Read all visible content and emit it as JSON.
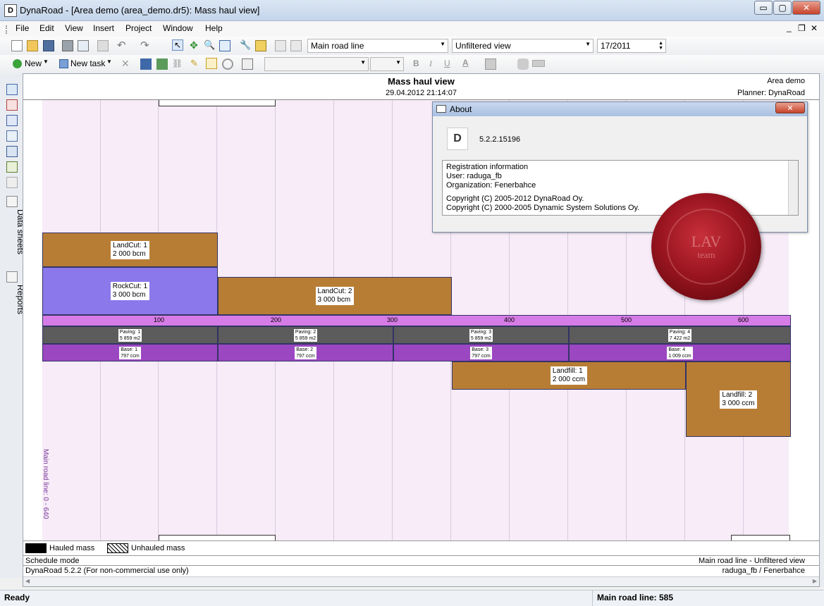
{
  "window": {
    "title": "DynaRoad - [Area demo (area_demo.dr5): Mass haul view]",
    "icon_letter": "D",
    "min": "▭",
    "max": "▢",
    "close": "✕"
  },
  "menu": [
    "File",
    "Edit",
    "View",
    "Insert",
    "Project",
    "Window",
    "Help"
  ],
  "mdi_controls": [
    "_",
    "❐",
    "✕"
  ],
  "toolbar1": {
    "road_line": "Main road line",
    "view": "Unfiltered view",
    "week": "17/2011"
  },
  "toolbar2": {
    "new_label": "New",
    "new_task_label": "New task",
    "bold": "B",
    "italic": "I",
    "underline": "U",
    "font_color": "A"
  },
  "sidebar": {
    "data_sheets": "Data sheets",
    "reports": "Reports"
  },
  "doc": {
    "title": "Mass haul view",
    "datetime": "29.04.2012 21:14:07",
    "project": "Area demo",
    "planner": "Planner: DynaRoad"
  },
  "chart_data": {
    "type": "mass-haul",
    "axis_label": "Main road line: 0 - 640",
    "station_ticks": [
      "100",
      "200",
      "300",
      "400",
      "500",
      "600"
    ],
    "cut_blocks": [
      {
        "label": "LandCut: 1",
        "value": "2 000 bcm",
        "start": 0,
        "end": 150
      },
      {
        "label": "RockCut: 1",
        "value": "3 000 bcm",
        "start": 0,
        "end": 150
      },
      {
        "label": "LandCut: 2",
        "value": "3 000 bcm",
        "start": 150,
        "end": 350
      }
    ],
    "paving": [
      {
        "label": "Paving: 1",
        "value": "5 859 m2"
      },
      {
        "label": "Paving: 2",
        "value": "5 859 m2"
      },
      {
        "label": "Paving: 3",
        "value": "5 859 m2"
      },
      {
        "label": "Paving: 4",
        "value": "7 422 m2"
      }
    ],
    "base": [
      {
        "label": "Base: 1",
        "value": "797 ccm"
      },
      {
        "label": "Base: 2",
        "value": "797 ccm"
      },
      {
        "label": "Base: 3",
        "value": "797 ccm"
      },
      {
        "label": "Base: 4",
        "value": "1 009 ccm"
      }
    ],
    "fill_blocks": [
      {
        "label": "Landfill: 1",
        "value": "2 000 ccm",
        "start": 350,
        "end": 550
      },
      {
        "label": "Landfill: 2",
        "value": "3 000 ccm",
        "start": 550,
        "end": 640
      }
    ]
  },
  "legend": {
    "hauled": "Hauled mass",
    "unhauled": "Unhauled mass"
  },
  "info": {
    "mode": "Schedule mode",
    "view": "Main road line - Unfiltered view",
    "version": "DynaRoad 5.2.2 (For non-commercial use only)",
    "user": "raduga_fb / Fenerbahce"
  },
  "about": {
    "title": "About",
    "close": "✕",
    "logo": "D",
    "version": "5.2.2.15196",
    "lines": [
      "Registration information",
      "User: raduga_fb",
      "Organization: Fenerbahce",
      "",
      "Copyright (C) 2005-2012 DynaRoad Oy.",
      "Copyright (C) 2000-2005 Dynamic System Solutions Oy."
    ]
  },
  "seal": {
    "text": "LAV",
    "sub": "team"
  },
  "status": {
    "left": "Ready",
    "right": "Main road line: 585"
  }
}
